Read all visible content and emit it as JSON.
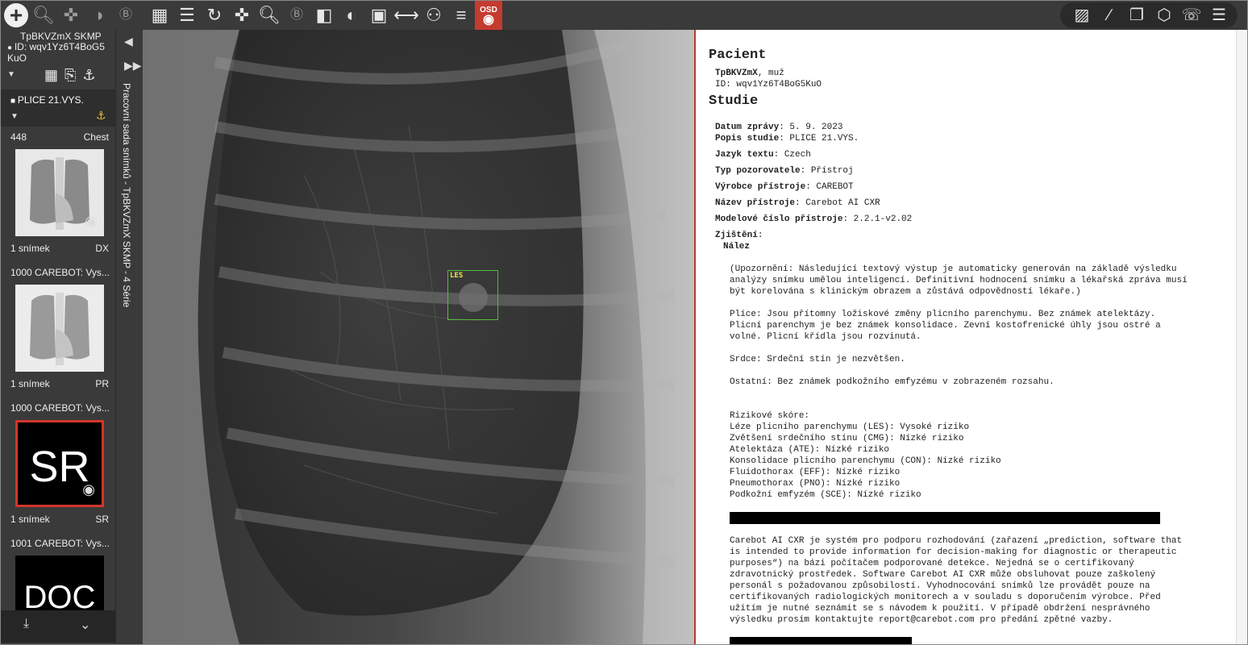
{
  "toolbar": {
    "left_icons": [
      "add-icon",
      "zoom-icon",
      "pan-icon",
      "contrast-icon",
      "b-icon"
    ],
    "main_icons": [
      "layout-icon",
      "series-list-icon",
      "rotate-icon",
      "move-icon",
      "zoom-icon",
      "b-icon",
      "invert-icon",
      "contrast-icon",
      "window-icon",
      "measure-line-icon",
      "body-icon",
      "layers-icon"
    ],
    "osd_label": "OSD",
    "right_icons": [
      "image-icon",
      "ruler-icon",
      "copy-icon",
      "cube-icon",
      "phone-icon",
      "menu-icon"
    ]
  },
  "patient": {
    "name": "TpBKVZmX SKMP",
    "id_line": "ID: wqv1Yz6T4BoG5 KuO"
  },
  "study": {
    "title": "PLICE 21.VYS."
  },
  "series": [
    {
      "number": "448",
      "modality_desc": "Chest",
      "count": "1 snímek",
      "modality": "DX",
      "kind": "xray"
    },
    {
      "number": "1000 CAREBOT: Vys...",
      "modality_desc": "",
      "count": "1 snímek",
      "modality": "PR",
      "kind": "xray"
    },
    {
      "number": "1000 CAREBOT: Vys...",
      "modality_desc": "",
      "count": "1 snímek",
      "modality": "SR",
      "kind": "text",
      "thumb_text": "SR"
    },
    {
      "number": "1001 CAREBOT: Vys...",
      "modality_desc": "",
      "count": "",
      "modality": "",
      "kind": "text",
      "thumb_text": "DOC"
    }
  ],
  "strip_label": "Pracovní sada snímků - TpBKVZmX SKMP - 4 Série",
  "viewer": {
    "roi_label": "LES"
  },
  "report": {
    "patient_heading": "Pacient",
    "patient_name": "TpBKVZmX",
    "patient_sex": ", muž",
    "patient_id": "ID: wqv1Yz6T4BoG5KuO",
    "study_heading": "Studie",
    "fields": [
      {
        "label": "Datum zprávy",
        "value": ": 5. 9. 2023"
      },
      {
        "label": "Popis studie",
        "value": ": PLICE 21.VYS."
      },
      {
        "label": "Jazyk textu",
        "value": ": Czech"
      },
      {
        "label": "Typ pozorovatele",
        "value": ": Přístroj"
      },
      {
        "label": "Výrobce přístroje",
        "value": ": CAREBOT"
      },
      {
        "label": "Název přístroje",
        "value": ": Carebot AI CXR"
      },
      {
        "label": "Modelové číslo přístroje",
        "value": ": 2.2.1-v2.02"
      }
    ],
    "findings_label": "Zjištění",
    "finding_label": "Nález",
    "notice": [
      "(Upozornění: Následující textový výstup je automaticky generován na základě výsledku",
      "analýzy snímku umělou inteligencí. Definitivní hodnocení snímku a lékařská zpráva musí",
      "být korelována s klinickým obrazem a zůstává odpovědností lékaře.)"
    ],
    "plice": [
      "Plíce: Jsou přítomny ložiskové změny plicního parenchymu. Bez známek atelektázy.",
      "Plicní parenchym je bez známek konsolidace. Zevní kostofrenické úhly jsou ostré a",
      "volné. Plicní křídla jsou rozvinutá."
    ],
    "srdce": "Srdce: Srdeční stín je nezvětšen.",
    "ostatni": "Ostatní: Bez známek podkožního emfyzému v zobrazeném rozsahu.",
    "risk_heading": "Rizikové skóre:",
    "risks": [
      "Léze plicního parenchymu (LES): Vysoké riziko",
      "Zvětšení srdečního stínu (CMG): Nízké riziko",
      "Atelektáza (ATE): Nízké riziko",
      "Konsolidace plicního parenchymu (CON): Nízké riziko",
      "Fluidothorax (EFF): Nízké riziko",
      "Pneumothorax (PNO): Nízké riziko",
      "Podkožní emfyzém (SCE): Nízké riziko"
    ],
    "disclaimer": [
      "Carebot AI CXR je systém pro podporu rozhodování (zařazení „prediction, software that",
      "is intended to provide information for decision-making for diagnostic or therapeutic",
      "purposes“) na bázi počítačem podporované detekce. Nejedná se o certifikovaný",
      "zdravotnický prostředek. Software Carebot AI CXR může obsluhovat pouze zaškolený",
      "personál s požadovanou způsobilostí. Vyhodnocování snímků lze provádět pouze na",
      "certifikovaných radiologických monitorech a v souladu s doporučením výrobce. Před",
      "užitím je nutné seznámit se s návodem k použití. V případě obdržení nesprávného",
      "výsledku prosím kontaktujte report@carebot.com pro předání zpětné vazby."
    ]
  }
}
